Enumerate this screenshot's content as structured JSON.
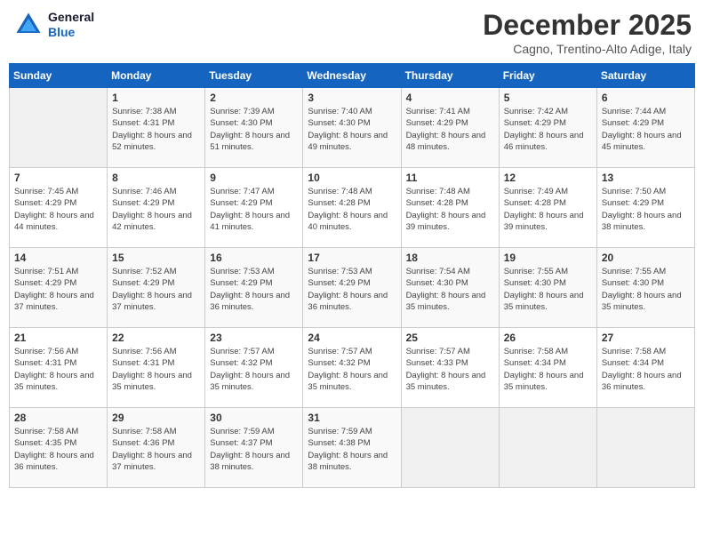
{
  "header": {
    "logo_line1": "General",
    "logo_line2": "Blue",
    "month": "December 2025",
    "location": "Cagno, Trentino-Alto Adige, Italy"
  },
  "weekdays": [
    "Sunday",
    "Monday",
    "Tuesday",
    "Wednesday",
    "Thursday",
    "Friday",
    "Saturday"
  ],
  "weeks": [
    [
      {
        "day": "",
        "sunrise": "",
        "sunset": "",
        "daylight": ""
      },
      {
        "day": "1",
        "sunrise": "Sunrise: 7:38 AM",
        "sunset": "Sunset: 4:31 PM",
        "daylight": "Daylight: 8 hours and 52 minutes."
      },
      {
        "day": "2",
        "sunrise": "Sunrise: 7:39 AM",
        "sunset": "Sunset: 4:30 PM",
        "daylight": "Daylight: 8 hours and 51 minutes."
      },
      {
        "day": "3",
        "sunrise": "Sunrise: 7:40 AM",
        "sunset": "Sunset: 4:30 PM",
        "daylight": "Daylight: 8 hours and 49 minutes."
      },
      {
        "day": "4",
        "sunrise": "Sunrise: 7:41 AM",
        "sunset": "Sunset: 4:29 PM",
        "daylight": "Daylight: 8 hours and 48 minutes."
      },
      {
        "day": "5",
        "sunrise": "Sunrise: 7:42 AM",
        "sunset": "Sunset: 4:29 PM",
        "daylight": "Daylight: 8 hours and 46 minutes."
      },
      {
        "day": "6",
        "sunrise": "Sunrise: 7:44 AM",
        "sunset": "Sunset: 4:29 PM",
        "daylight": "Daylight: 8 hours and 45 minutes."
      }
    ],
    [
      {
        "day": "7",
        "sunrise": "Sunrise: 7:45 AM",
        "sunset": "Sunset: 4:29 PM",
        "daylight": "Daylight: 8 hours and 44 minutes."
      },
      {
        "day": "8",
        "sunrise": "Sunrise: 7:46 AM",
        "sunset": "Sunset: 4:29 PM",
        "daylight": "Daylight: 8 hours and 42 minutes."
      },
      {
        "day": "9",
        "sunrise": "Sunrise: 7:47 AM",
        "sunset": "Sunset: 4:29 PM",
        "daylight": "Daylight: 8 hours and 41 minutes."
      },
      {
        "day": "10",
        "sunrise": "Sunrise: 7:48 AM",
        "sunset": "Sunset: 4:28 PM",
        "daylight": "Daylight: 8 hours and 40 minutes."
      },
      {
        "day": "11",
        "sunrise": "Sunrise: 7:48 AM",
        "sunset": "Sunset: 4:28 PM",
        "daylight": "Daylight: 8 hours and 39 minutes."
      },
      {
        "day": "12",
        "sunrise": "Sunrise: 7:49 AM",
        "sunset": "Sunset: 4:28 PM",
        "daylight": "Daylight: 8 hours and 39 minutes."
      },
      {
        "day": "13",
        "sunrise": "Sunrise: 7:50 AM",
        "sunset": "Sunset: 4:29 PM",
        "daylight": "Daylight: 8 hours and 38 minutes."
      }
    ],
    [
      {
        "day": "14",
        "sunrise": "Sunrise: 7:51 AM",
        "sunset": "Sunset: 4:29 PM",
        "daylight": "Daylight: 8 hours and 37 minutes."
      },
      {
        "day": "15",
        "sunrise": "Sunrise: 7:52 AM",
        "sunset": "Sunset: 4:29 PM",
        "daylight": "Daylight: 8 hours and 37 minutes."
      },
      {
        "day": "16",
        "sunrise": "Sunrise: 7:53 AM",
        "sunset": "Sunset: 4:29 PM",
        "daylight": "Daylight: 8 hours and 36 minutes."
      },
      {
        "day": "17",
        "sunrise": "Sunrise: 7:53 AM",
        "sunset": "Sunset: 4:29 PM",
        "daylight": "Daylight: 8 hours and 36 minutes."
      },
      {
        "day": "18",
        "sunrise": "Sunrise: 7:54 AM",
        "sunset": "Sunset: 4:30 PM",
        "daylight": "Daylight: 8 hours and 35 minutes."
      },
      {
        "day": "19",
        "sunrise": "Sunrise: 7:55 AM",
        "sunset": "Sunset: 4:30 PM",
        "daylight": "Daylight: 8 hours and 35 minutes."
      },
      {
        "day": "20",
        "sunrise": "Sunrise: 7:55 AM",
        "sunset": "Sunset: 4:30 PM",
        "daylight": "Daylight: 8 hours and 35 minutes."
      }
    ],
    [
      {
        "day": "21",
        "sunrise": "Sunrise: 7:56 AM",
        "sunset": "Sunset: 4:31 PM",
        "daylight": "Daylight: 8 hours and 35 minutes."
      },
      {
        "day": "22",
        "sunrise": "Sunrise: 7:56 AM",
        "sunset": "Sunset: 4:31 PM",
        "daylight": "Daylight: 8 hours and 35 minutes."
      },
      {
        "day": "23",
        "sunrise": "Sunrise: 7:57 AM",
        "sunset": "Sunset: 4:32 PM",
        "daylight": "Daylight: 8 hours and 35 minutes."
      },
      {
        "day": "24",
        "sunrise": "Sunrise: 7:57 AM",
        "sunset": "Sunset: 4:32 PM",
        "daylight": "Daylight: 8 hours and 35 minutes."
      },
      {
        "day": "25",
        "sunrise": "Sunrise: 7:57 AM",
        "sunset": "Sunset: 4:33 PM",
        "daylight": "Daylight: 8 hours and 35 minutes."
      },
      {
        "day": "26",
        "sunrise": "Sunrise: 7:58 AM",
        "sunset": "Sunset: 4:34 PM",
        "daylight": "Daylight: 8 hours and 35 minutes."
      },
      {
        "day": "27",
        "sunrise": "Sunrise: 7:58 AM",
        "sunset": "Sunset: 4:34 PM",
        "daylight": "Daylight: 8 hours and 36 minutes."
      }
    ],
    [
      {
        "day": "28",
        "sunrise": "Sunrise: 7:58 AM",
        "sunset": "Sunset: 4:35 PM",
        "daylight": "Daylight: 8 hours and 36 minutes."
      },
      {
        "day": "29",
        "sunrise": "Sunrise: 7:58 AM",
        "sunset": "Sunset: 4:36 PM",
        "daylight": "Daylight: 8 hours and 37 minutes."
      },
      {
        "day": "30",
        "sunrise": "Sunrise: 7:59 AM",
        "sunset": "Sunset: 4:37 PM",
        "daylight": "Daylight: 8 hours and 38 minutes."
      },
      {
        "day": "31",
        "sunrise": "Sunrise: 7:59 AM",
        "sunset": "Sunset: 4:38 PM",
        "daylight": "Daylight: 8 hours and 38 minutes."
      },
      {
        "day": "",
        "sunrise": "",
        "sunset": "",
        "daylight": ""
      },
      {
        "day": "",
        "sunrise": "",
        "sunset": "",
        "daylight": ""
      },
      {
        "day": "",
        "sunrise": "",
        "sunset": "",
        "daylight": ""
      }
    ]
  ]
}
